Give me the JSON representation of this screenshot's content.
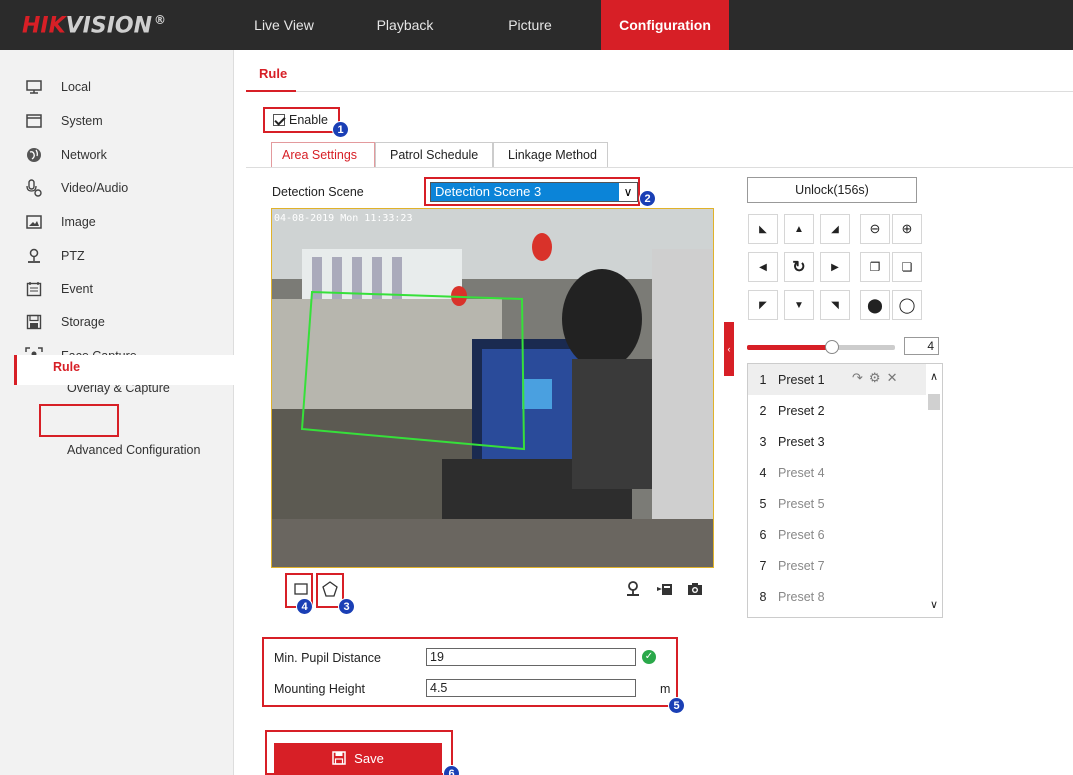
{
  "brand": {
    "name_part1": "HIK",
    "name_part2": "VISION",
    "reg": "®"
  },
  "nav": [
    {
      "label": "Live View"
    },
    {
      "label": "Playback"
    },
    {
      "label": "Picture"
    },
    {
      "label": "Configuration",
      "active": true
    }
  ],
  "sidebar": {
    "items": [
      {
        "label": "Local",
        "icon": "monitor-icon"
      },
      {
        "label": "System",
        "icon": "system-icon"
      },
      {
        "label": "Network",
        "icon": "globe-icon"
      },
      {
        "label": "Video/Audio",
        "icon": "video-audio-icon"
      },
      {
        "label": "Image",
        "icon": "image-icon"
      },
      {
        "label": "PTZ",
        "icon": "ptz-icon"
      },
      {
        "label": "Event",
        "icon": "calendar-icon"
      },
      {
        "label": "Storage",
        "icon": "storage-icon"
      },
      {
        "label": "Face Capture",
        "icon": "face-capture-icon"
      }
    ],
    "subitems": [
      {
        "label": "Overlay & Capture"
      },
      {
        "label": "Rule",
        "active": true
      },
      {
        "label": "Advanced Configuration"
      }
    ]
  },
  "page_tab": "Rule",
  "enable": {
    "label": "Enable",
    "checked": true
  },
  "subtabs": [
    {
      "label": "Area Settings",
      "active": true
    },
    {
      "label": "Patrol Schedule"
    },
    {
      "label": "Linkage Method"
    }
  ],
  "detection_scene": {
    "label": "Detection Scene",
    "value": "Detection Scene 3"
  },
  "video": {
    "osd": "04-08-2019 Mon 11:33:23"
  },
  "ptz": {
    "unlock_label": "Unlock(156s)",
    "speed": 4,
    "speed_max": 7,
    "presets": [
      {
        "num": "1",
        "name": "Preset 1"
      },
      {
        "num": "2",
        "name": "Preset 2"
      },
      {
        "num": "3",
        "name": "Preset 3"
      },
      {
        "num": "4",
        "name": "Preset 4"
      },
      {
        "num": "5",
        "name": "Preset 5"
      },
      {
        "num": "6",
        "name": "Preset 6"
      },
      {
        "num": "7",
        "name": "Preset 7"
      },
      {
        "num": "8",
        "name": "Preset 8"
      }
    ]
  },
  "params": {
    "pupil_label": "Min. Pupil Distance",
    "pupil_value": "19",
    "height_label": "Mounting Height",
    "height_value": "4.5",
    "height_unit": "m"
  },
  "save_label": "Save",
  "badges": [
    "1",
    "2",
    "3",
    "4",
    "5",
    "6"
  ],
  "colors": {
    "accent": "#d71f26",
    "badge": "#1a3fb5",
    "select": "#0b84d8"
  }
}
